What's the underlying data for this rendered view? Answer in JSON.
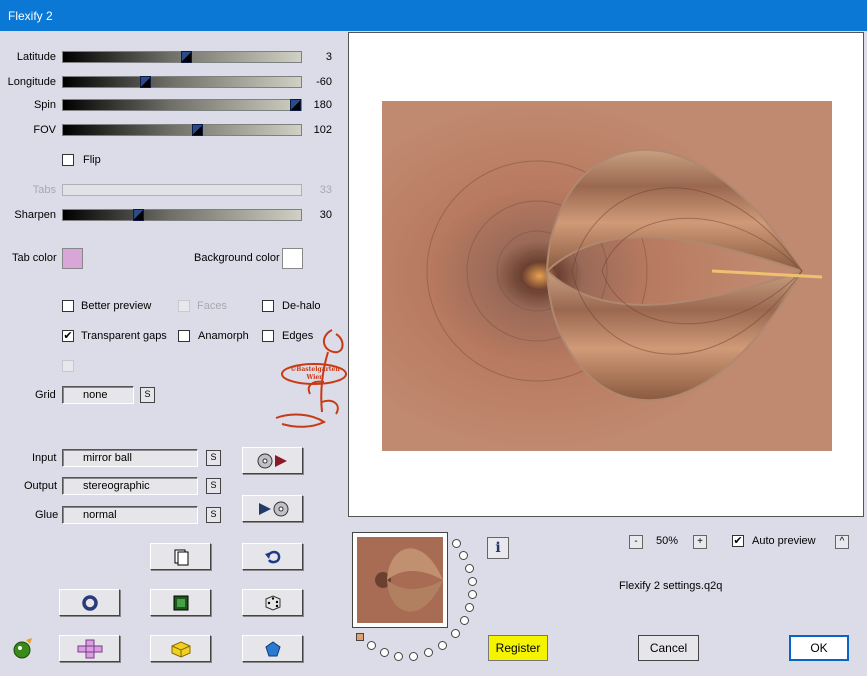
{
  "window": {
    "title": "Flexify 2"
  },
  "sliders": [
    {
      "id": "latitude",
      "label": "Latitude",
      "value": "3",
      "fraction": 0.52,
      "enabled": true
    },
    {
      "id": "longitude",
      "label": "Longitude",
      "value": "-60",
      "fraction": 0.34,
      "enabled": true
    },
    {
      "id": "spin",
      "label": "Spin",
      "value": "180",
      "fraction": 1.0,
      "enabled": true
    },
    {
      "id": "fov",
      "label": "FOV",
      "value": "102",
      "fraction": 0.57,
      "enabled": true
    },
    {
      "id": "tabs",
      "label": "Tabs",
      "value": "33",
      "fraction": 0.0,
      "enabled": false
    },
    {
      "id": "sharpen",
      "label": "Sharpen",
      "value": "30",
      "fraction": 0.31,
      "enabled": true
    }
  ],
  "flip": {
    "label": "Flip",
    "checked": false
  },
  "colors": {
    "tab_color_label": "Tab color",
    "tab_color": "#d8a6d8",
    "background_color_label": "Background color",
    "background_color": "#ffffff"
  },
  "options": {
    "better_preview": {
      "label": "Better preview",
      "checked": false
    },
    "faces": {
      "label": "Faces",
      "checked": false
    },
    "de_halo": {
      "label": "De-halo",
      "checked": false
    },
    "transparent_gaps": {
      "label": "Transparent gaps",
      "checked": true
    },
    "anamorph": {
      "label": "Anamorph",
      "checked": false
    },
    "edges": {
      "label": "Edges",
      "checked": false
    }
  },
  "watermark": {
    "text": "©Bastelgarten Wien"
  },
  "grid": {
    "label": "Grid",
    "value": "none",
    "s_label": "S"
  },
  "projection": {
    "input_label": "Input",
    "input_value": "mirror ball",
    "output_label": "Output",
    "output_value": "stereographic",
    "glue_label": "Glue",
    "glue_value": "normal",
    "s_label": "S"
  },
  "zoom": {
    "minus": "-",
    "value": "50%",
    "plus": "+"
  },
  "auto_preview": {
    "label": "Auto preview",
    "checked": true,
    "arrow": "^"
  },
  "settings_file": "Flexify 2 settings.q2q",
  "info_label": "i",
  "buttons": {
    "register": "Register",
    "cancel": "Cancel",
    "ok": "OK"
  },
  "accent_colors": {
    "title_bar": "#0a78d4",
    "register": "#f4f400",
    "ok_border": "#0a64c8"
  }
}
